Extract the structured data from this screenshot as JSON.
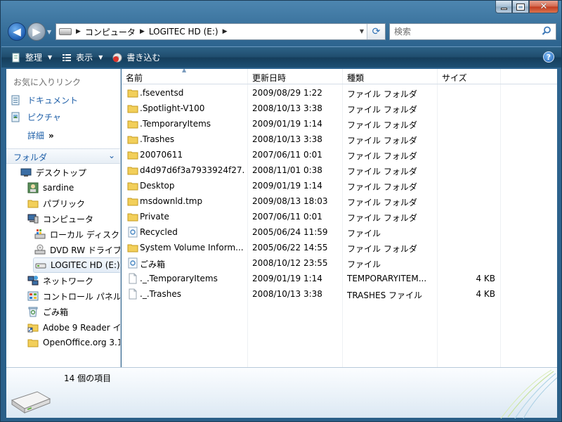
{
  "window": {
    "caption_buttons": {
      "minimize": "minimize",
      "maximize": "maximize",
      "close": "close"
    }
  },
  "address": {
    "crumbs": [
      "コンピュータ",
      "LOGITEC HD (E:)"
    ]
  },
  "search": {
    "placeholder": "検索"
  },
  "toolbar": {
    "organize": "整理",
    "views": "表示",
    "burn": "書き込む"
  },
  "sidebar": {
    "favorites_header": "お気に入りリンク",
    "favorites": [
      {
        "label": "ドキュメント",
        "icon": "documents-icon"
      },
      {
        "label": "ピクチャ",
        "icon": "pictures-icon"
      }
    ],
    "details_label": "詳細",
    "details_chevron": "»",
    "folders_header": "フォルダ",
    "tree": [
      {
        "label": "デスクトップ",
        "icon": "desktop-icon",
        "level": 0
      },
      {
        "label": "sardine",
        "icon": "user-icon",
        "level": 1
      },
      {
        "label": "パブリック",
        "icon": "folder-icon",
        "level": 1
      },
      {
        "label": "コンピュータ",
        "icon": "computer-icon",
        "level": 1
      },
      {
        "label": "ローカル ディスク",
        "icon": "local-disk-icon",
        "level": 2
      },
      {
        "label": "DVD RW ドライブ",
        "icon": "dvd-drive-icon",
        "level": 2
      },
      {
        "label": "LOGITEC HD (E:)",
        "icon": "usb-drive-icon",
        "level": 2,
        "selected": true
      },
      {
        "label": "ネットワーク",
        "icon": "network-icon",
        "level": 1
      },
      {
        "label": "コントロール パネル",
        "icon": "control-panel-icon",
        "level": 1
      },
      {
        "label": "ごみ箱",
        "icon": "recycle-bin-icon",
        "level": 1
      },
      {
        "label": "Adobe 9 Reader イ",
        "icon": "shortcut-folder-icon",
        "level": 1
      },
      {
        "label": "OpenOffice.org 3.1",
        "icon": "folder-icon",
        "level": 1
      }
    ]
  },
  "columns": [
    "名前",
    "更新日時",
    "種類",
    "サイズ"
  ],
  "files": [
    {
      "name": ".fseventsd",
      "date": "2009/08/29 1:22",
      "type": "ファイル フォルダ",
      "size": "",
      "icon": "folder-icon"
    },
    {
      "name": ".Spotlight-V100",
      "date": "2008/10/13 3:38",
      "type": "ファイル フォルダ",
      "size": "",
      "icon": "folder-icon"
    },
    {
      "name": ".TemporaryItems",
      "date": "2009/01/19 1:14",
      "type": "ファイル フォルダ",
      "size": "",
      "icon": "folder-icon"
    },
    {
      "name": ".Trashes",
      "date": "2008/10/13 3:38",
      "type": "ファイル フォルダ",
      "size": "",
      "icon": "folder-icon"
    },
    {
      "name": "20070611",
      "date": "2007/06/11 0:01",
      "type": "ファイル フォルダ",
      "size": "",
      "icon": "folder-icon"
    },
    {
      "name": "d4d97d6f3a7933924f27...",
      "date": "2008/11/01 0:38",
      "type": "ファイル フォルダ",
      "size": "",
      "icon": "folder-icon"
    },
    {
      "name": "Desktop",
      "date": "2009/01/19 1:14",
      "type": "ファイル フォルダ",
      "size": "",
      "icon": "folder-icon"
    },
    {
      "name": "msdownld.tmp",
      "date": "2009/08/13 18:03",
      "type": "ファイル フォルダ",
      "size": "",
      "icon": "folder-icon"
    },
    {
      "name": "Private",
      "date": "2007/06/11 0:01",
      "type": "ファイル フォルダ",
      "size": "",
      "icon": "folder-icon"
    },
    {
      "name": "Recycled",
      "date": "2005/06/24 11:59",
      "type": "ファイル",
      "size": "",
      "icon": "recycle-file-icon"
    },
    {
      "name": "System Volume Inform...",
      "date": "2005/06/22 14:55",
      "type": "ファイル フォルダ",
      "size": "",
      "icon": "folder-icon"
    },
    {
      "name": "ごみ箱",
      "date": "2008/10/12 23:55",
      "type": "ファイル",
      "size": "",
      "icon": "recycle-file-icon"
    },
    {
      "name": "._.TemporaryItems",
      "date": "2009/01/19 1:14",
      "type": "TEMPORARYITEM...",
      "size": "4 KB",
      "icon": "file-icon"
    },
    {
      "name": "._.Trashes",
      "date": "2008/10/13 3:38",
      "type": "TRASHES ファイル",
      "size": "4 KB",
      "icon": "file-icon"
    }
  ],
  "status": {
    "item_count": "14 個の項目"
  }
}
